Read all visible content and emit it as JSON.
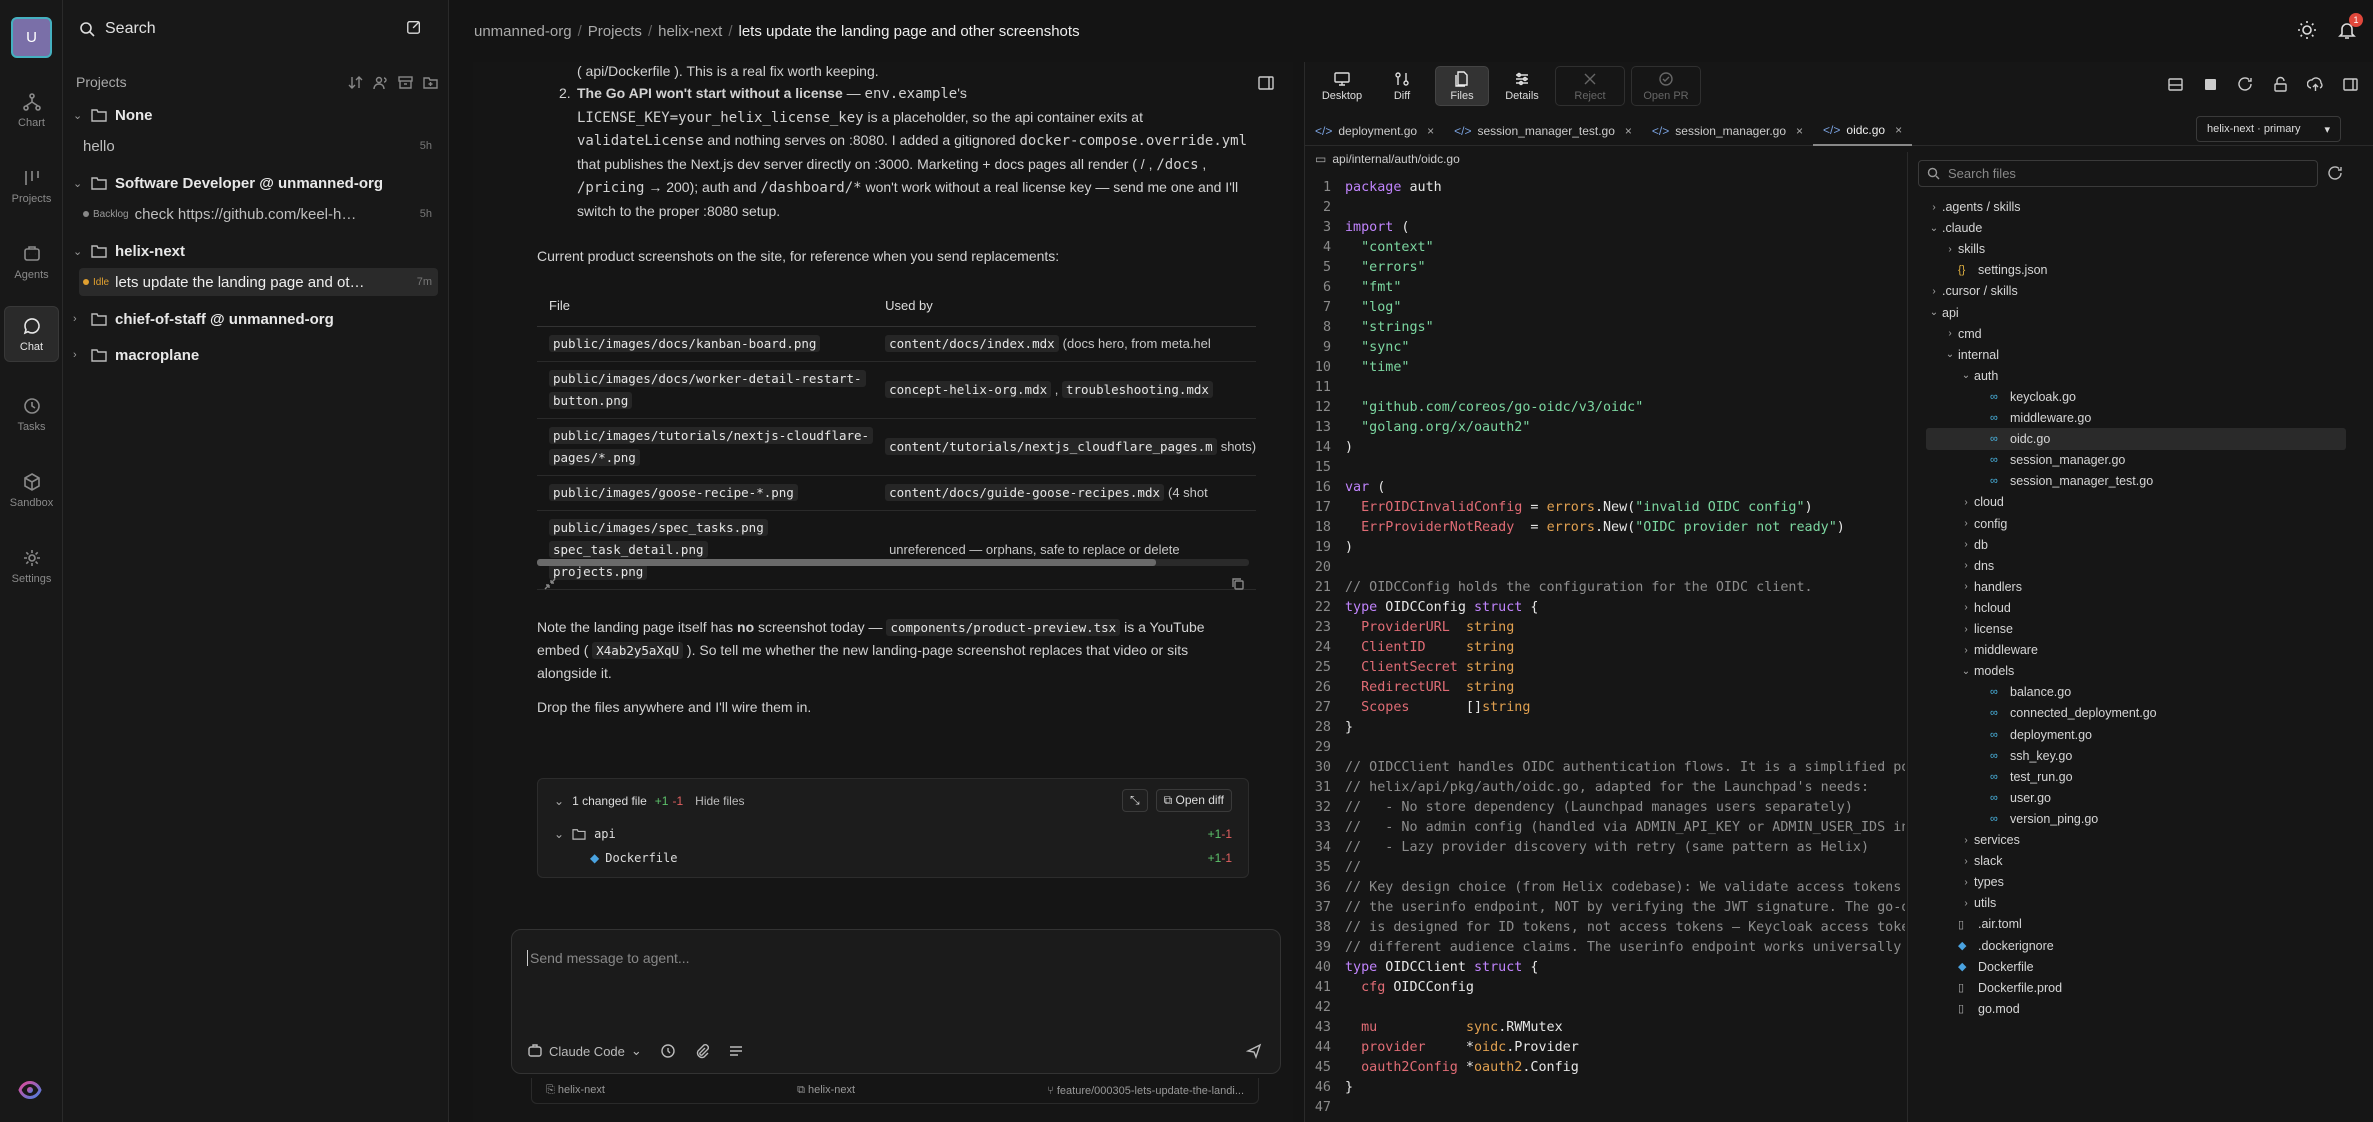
{
  "rail": {
    "avatar": "U",
    "items": [
      {
        "label": "Chart"
      },
      {
        "label": "Projects"
      },
      {
        "label": "Agents"
      },
      {
        "label": "Chat"
      },
      {
        "label": "Tasks"
      },
      {
        "label": "Sandbox"
      },
      {
        "label": "Settings"
      }
    ]
  },
  "sidebar": {
    "search": "Search",
    "projects_heading": "Projects",
    "groups": [
      {
        "name": "None",
        "chats": [
          {
            "text": "hello",
            "time": "5h"
          }
        ]
      },
      {
        "name": "Software Developer @ unmanned-org",
        "chats": [
          {
            "tag": "Backlog",
            "text": "check https://github.com/keel-hq/k...",
            "time": "5h"
          }
        ]
      },
      {
        "name": "helix-next",
        "chats": [
          {
            "tag": "Idle",
            "text": "lets update the landing page and oth...",
            "time": "7m"
          }
        ]
      },
      {
        "name": "chief-of-staff @ unmanned-org"
      },
      {
        "name": "macroplane"
      }
    ]
  },
  "breadcrumb": {
    "org": "unmanned-org",
    "projects": "Projects",
    "project": "helix-next",
    "current": "lets update the landing page and other screenshots",
    "sep": "/",
    "notif_count": "1"
  },
  "chat": {
    "top_fragment": "( api/Dockerfile ). This is a real fix worth keeping.",
    "item2_title": "The Go API won't start without a license",
    "item2_a": "env.example",
    "item2_b": "LICENSE_KEY=your_helix_license_key",
    "item2_c": "validateLicense",
    "item2_d": "docker-compose.override.yml",
    "item2_e": "/docs",
    "item2_f": "/pricing",
    "item2_g": "/dashboard/*",
    "item2_text1": " — ",
    "item2_text2": "'s ",
    "item2_text3": " is a placeholder, so the api container exits at ",
    "item2_text4": " and nothing serves on :8080. I added a gitignored ",
    "item2_text5": " that publishes the Next.js dev server directly on :3000. Marketing + docs pages all render ( / , ",
    "item2_text6": " , ",
    "item2_text7": " → 200); auth and ",
    "item2_text8": " won't work without a real license key — send me one and I'll switch to the proper :8080 setup.",
    "intro": "Current product screenshots on the site, for reference when you send replacements:",
    "table": {
      "headers": [
        "File",
        "Used by"
      ],
      "rows": [
        {
          "file": [
            "public/images/docs/kanban-board.png"
          ],
          "used": [
            "content/docs/index.mdx"
          ],
          "note": "(docs hero, from meta.hel"
        },
        {
          "file": [
            "public/images/docs/worker-detail-restart-",
            "button.png"
          ],
          "used": [
            "concept-helix-org.mdx",
            "troubleshooting.mdx"
          ],
          "note": ""
        },
        {
          "file": [
            "public/images/tutorials/nextjs-cloudflare-",
            "pages/*.png"
          ],
          "used": [
            "content/tutorials/nextjs_cloudflare_pages.m"
          ],
          "note": "shots)"
        },
        {
          "file": [
            "public/images/goose-recipe-*.png"
          ],
          "used": [
            "content/docs/guide-goose-recipes.mdx"
          ],
          "note": "(4 shot"
        },
        {
          "file": [
            "public/images/spec_tasks.png",
            "spec_task_detail.png",
            "projects.png"
          ],
          "used": [],
          "note": "unreferenced — orphans, safe to replace or delete"
        }
      ]
    },
    "note_pre": "Note the landing page itself has ",
    "note_bold": "no",
    "note_mid": " screenshot today — ",
    "note_code": "components/product-preview.tsx",
    "note_mid2": " is a YouTube embed ( ",
    "note_code2": "X4ab2y5aXqU",
    "note_end": " ). So tell me whether the new landing-page screenshot replaces that video or sits alongside it.",
    "drop": "Drop the files anywhere and I'll wire them in.",
    "changed": {
      "title": "1 changed file",
      "adds": "+1",
      "dels": "-1",
      "hide": "Hide files",
      "open": "Open diff",
      "folder": "api",
      "file": "Dockerfile"
    },
    "composer": {
      "placeholder": "Send message to agent...",
      "agent": "Claude Code"
    },
    "status": {
      "left": "helix-next",
      "mid": "helix-next",
      "right": "feature/000305-lets-update-the-landi..."
    }
  },
  "right": {
    "toolbar": [
      "Desktop",
      "Diff",
      "Files",
      "Details",
      "Reject",
      "Open PR"
    ],
    "tabs": [
      "deployment.go",
      "session_manager_test.go",
      "session_manager.go",
      "oidc.go"
    ],
    "branch": "helix-next · primary",
    "filepath": "api/internal/auth/oidc.go",
    "file_search": "Search files",
    "code": [
      "package auth",
      "",
      "import (",
      "\t\"context\"",
      "\t\"errors\"",
      "\t\"fmt\"",
      "\t\"log\"",
      "\t\"strings\"",
      "\t\"sync\"",
      "\t\"time\"",
      "",
      "\t\"github.com/coreos/go-oidc/v3/oidc\"",
      "\t\"golang.org/x/oauth2\"",
      ")",
      "",
      "var (",
      "\tErrOIDCInvalidConfig = errors.New(\"invalid OIDC config\")",
      "\tErrProviderNotReady  = errors.New(\"OIDC provider not ready\")",
      ")",
      "",
      "// OIDCConfig holds the configuration for the OIDC client.",
      "type OIDCConfig struct {",
      "\tProviderURL  string",
      "\tClientID     string",
      "\tClientSecret string",
      "\tRedirectURL  string",
      "\tScopes       []string",
      "}",
      "",
      "// OIDCClient handles OIDC authentication flows. It is a simplified po",
      "// helix/api/pkg/auth/oidc.go, adapted for the Launchpad's needs:",
      "//   - No store dependency (Launchpad manages users separately)",
      "//   - No admin config (handled via ADMIN_API_KEY or ADMIN_USER_IDS in",
      "//   - Lazy provider discovery with retry (same pattern as Helix)",
      "//",
      "// Key design choice (from Helix codebase): We validate access tokens",
      "// the userinfo endpoint, NOT by verifying the JWT signature. The go-o",
      "// is designed for ID tokens, not access tokens — Keycloak access toke",
      "// different audience claims. The userinfo endpoint works universally",
      "type OIDCClient struct {",
      "\tcfg OIDCConfig",
      "",
      "\tmu           sync.RWMutex",
      "\tprovider     *oidc.Provider",
      "\toauth2Config *oauth2.Config",
      "}",
      ""
    ],
    "tree": [
      {
        "d": 0,
        "t": "folder",
        "open": false,
        "n": ".agents / skills"
      },
      {
        "d": 0,
        "t": "folder",
        "open": true,
        "n": ".claude"
      },
      {
        "d": 1,
        "t": "folder",
        "open": false,
        "n": "skills"
      },
      {
        "d": 1,
        "t": "json",
        "n": "settings.json"
      },
      {
        "d": 0,
        "t": "folder",
        "open": false,
        "n": ".cursor / skills"
      },
      {
        "d": 0,
        "t": "folder",
        "open": true,
        "n": "api"
      },
      {
        "d": 1,
        "t": "folder",
        "open": false,
        "n": "cmd"
      },
      {
        "d": 1,
        "t": "folder",
        "open": true,
        "n": "internal"
      },
      {
        "d": 2,
        "t": "folder",
        "open": true,
        "n": "auth"
      },
      {
        "d": 3,
        "t": "go",
        "n": "keycloak.go"
      },
      {
        "d": 3,
        "t": "go",
        "n": "middleware.go"
      },
      {
        "d": 3,
        "t": "go",
        "n": "oidc.go",
        "sel": true
      },
      {
        "d": 3,
        "t": "go",
        "n": "session_manager.go"
      },
      {
        "d": 3,
        "t": "go",
        "n": "session_manager_test.go"
      },
      {
        "d": 2,
        "t": "folder",
        "open": false,
        "n": "cloud"
      },
      {
        "d": 2,
        "t": "folder",
        "open": false,
        "n": "config"
      },
      {
        "d": 2,
        "t": "folder",
        "open": false,
        "n": "db"
      },
      {
        "d": 2,
        "t": "folder",
        "open": false,
        "n": "dns"
      },
      {
        "d": 2,
        "t": "folder",
        "open": false,
        "n": "handlers"
      },
      {
        "d": 2,
        "t": "folder",
        "open": false,
        "n": "hcloud"
      },
      {
        "d": 2,
        "t": "folder",
        "open": false,
        "n": "license"
      },
      {
        "d": 2,
        "t": "folder",
        "open": false,
        "n": "middleware"
      },
      {
        "d": 2,
        "t": "folder",
        "open": true,
        "n": "models"
      },
      {
        "d": 3,
        "t": "go",
        "n": "balance.go"
      },
      {
        "d": 3,
        "t": "go",
        "n": "connected_deployment.go"
      },
      {
        "d": 3,
        "t": "go",
        "n": "deployment.go"
      },
      {
        "d": 3,
        "t": "go",
        "n": "ssh_key.go"
      },
      {
        "d": 3,
        "t": "go",
        "n": "test_run.go"
      },
      {
        "d": 3,
        "t": "go",
        "n": "user.go"
      },
      {
        "d": 3,
        "t": "go",
        "n": "version_ping.go"
      },
      {
        "d": 2,
        "t": "folder",
        "open": false,
        "n": "services"
      },
      {
        "d": 2,
        "t": "folder",
        "open": false,
        "n": "slack"
      },
      {
        "d": 2,
        "t": "folder",
        "open": false,
        "n": "types"
      },
      {
        "d": 2,
        "t": "folder",
        "open": false,
        "n": "utils"
      },
      {
        "d": 1,
        "t": "file",
        "n": ".air.toml"
      },
      {
        "d": 1,
        "t": "docker",
        "n": ".dockerignore"
      },
      {
        "d": 1,
        "t": "docker",
        "n": "Dockerfile"
      },
      {
        "d": 1,
        "t": "file",
        "n": "Dockerfile.prod"
      },
      {
        "d": 1,
        "t": "file",
        "n": "go.mod"
      }
    ]
  }
}
